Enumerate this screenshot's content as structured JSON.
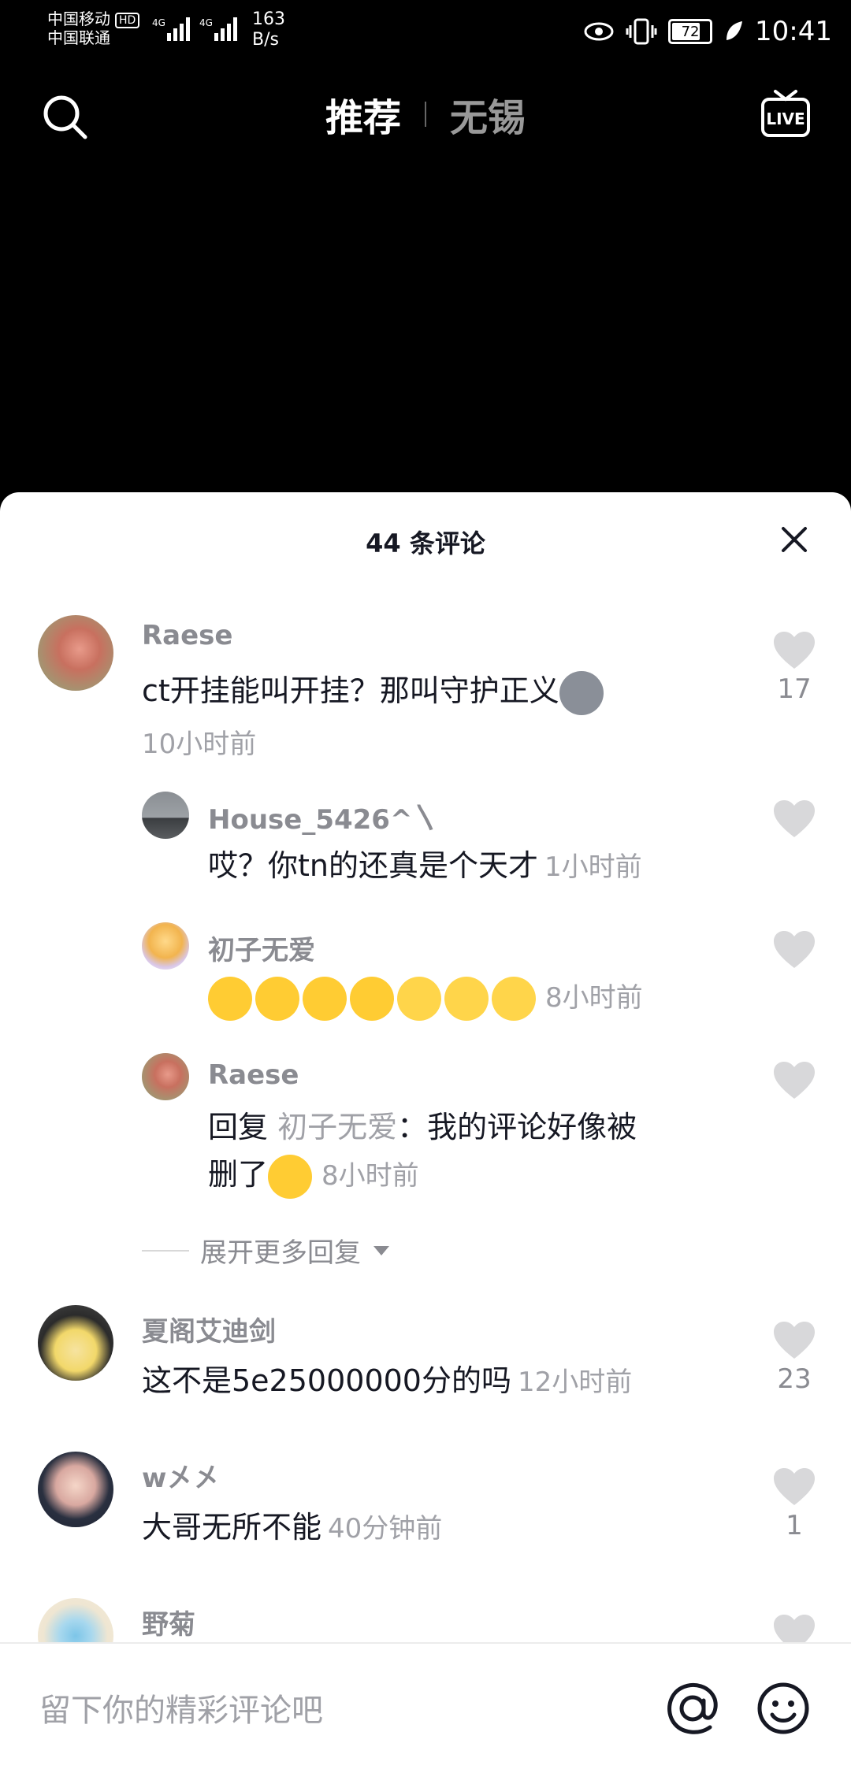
{
  "status_bar": {
    "carrier1": "中国移动",
    "carrier1_badge": "HD",
    "carrier2": "中国联通",
    "signal1": "4G",
    "signal2": "4G",
    "net_speed_value": "163",
    "net_speed_unit": "B/s",
    "battery": "72",
    "time": "10:41"
  },
  "topnav": {
    "tab_recommend": "推荐",
    "tab_local": "无锡"
  },
  "sheet": {
    "title": "44 条评论"
  },
  "comments": [
    {
      "username": "Raese",
      "text": "ct开挂能叫开挂？那叫守护正义",
      "time": "10小时前",
      "likes": "17"
    },
    {
      "username": "House_5426^〵",
      "text": "哎？你tn的还真是个天才",
      "time": "1小时前"
    },
    {
      "username": "初子无爱",
      "time": "8小时前"
    },
    {
      "username": "Raese",
      "reply_prefix": "回复",
      "reply_to": "初子无爱",
      "text_line1": "：我的评论好像被",
      "text_line2": "删了",
      "time": "8小时前"
    },
    {
      "username": "夏阁艾迪剑",
      "text": "这不是5e25000000分的吗",
      "time": "12小时前",
      "likes": "23"
    },
    {
      "username": "w㐅㐅",
      "text": "大哥无所不能",
      "time": "40分钟前",
      "likes": "1"
    },
    {
      "username": "野菊"
    }
  ],
  "expand_replies": "展开更多回复",
  "input": {
    "placeholder": "留下你的精彩评论吧"
  },
  "icons": {
    "search": "search-icon",
    "live": "live-tv-icon",
    "close": "close-icon",
    "like": "heart-icon",
    "at": "at-icon",
    "emoji": "smiley-icon"
  }
}
